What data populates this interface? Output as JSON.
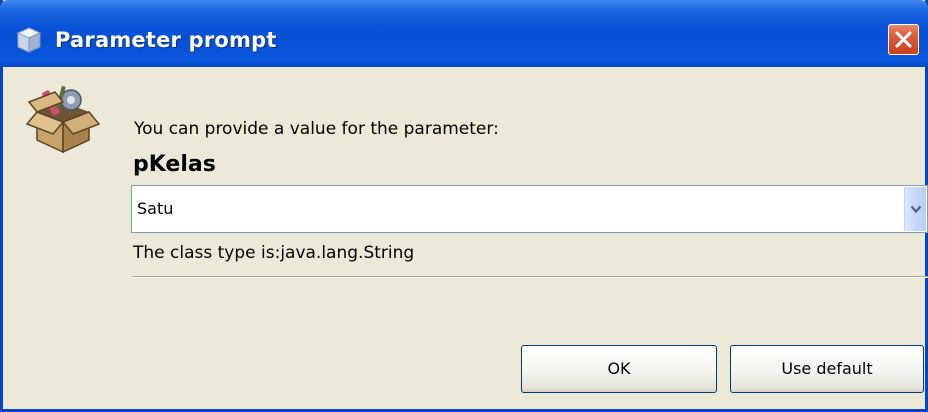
{
  "window": {
    "title": "Parameter prompt"
  },
  "prompt": {
    "message": "You can provide a value for the parameter:",
    "parameter_name": "pKelas"
  },
  "value_select": {
    "selected_value": "Satu"
  },
  "type_info": "The class type is:java.lang.String",
  "buttons": {
    "ok_label": "OK",
    "default_label": "Use default"
  },
  "icons": {
    "title": "cube-icon",
    "close": "close-icon",
    "dialog": "open-box-icon",
    "dropdown": "chevron-down-icon"
  },
  "colors": {
    "titlebar": "#0a53d8",
    "window_bg": "#ece9d8",
    "close_button": "#d9542f"
  }
}
